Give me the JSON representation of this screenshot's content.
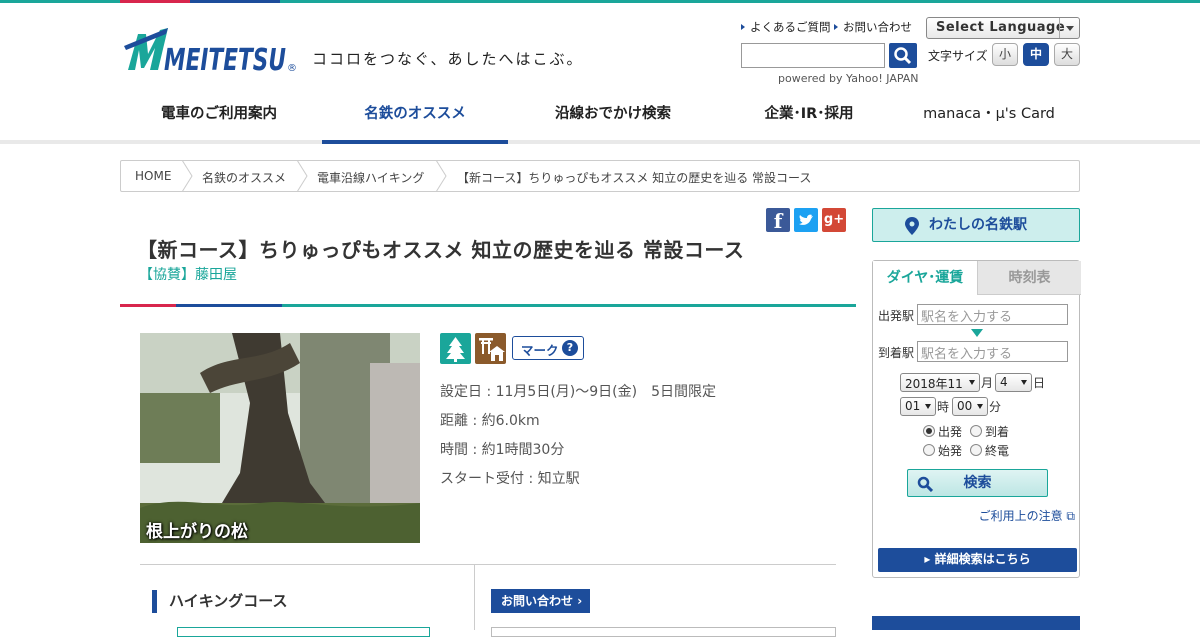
{
  "colors": {
    "teal": "#1aa69a",
    "navy": "#1d4d9b",
    "red": "#d8264d"
  },
  "header": {
    "logo_text": "MEITETSU",
    "logo_mark": "®",
    "tagline": "ココロをつなぐ、あしたへはこぶ。",
    "faq": "よくあるご質問",
    "contact": "お問い合わせ",
    "language": "Select Language",
    "powered": "powered by Yahoo! JAPAN",
    "fontsize_label": "文字サイズ",
    "fontsize": [
      "小",
      "中",
      "大"
    ],
    "fontsize_active": "中"
  },
  "nav": [
    "電車のご利用案内",
    "名鉄のオススメ",
    "沿線おでかけ検索",
    "企業･IR･採用",
    "manaca・μ's Card"
  ],
  "nav_active": "名鉄のオススメ",
  "breadcrumb": [
    "HOME",
    "名鉄のオススメ",
    "電車沿線ハイキング",
    "【新コース】ちりゅっぴもオススメ 知立の歴史を辿る 常設コース"
  ],
  "social": {
    "facebook": "f",
    "twitter": "twitter-icon",
    "googleplus": "g+"
  },
  "article": {
    "title": "【新コース】ちりゅっぴもオススメ 知立の歴史を辿る 常設コース",
    "sponsor": "【協賛】藤田屋",
    "photo_caption": "根上がりの松",
    "mark_button": "マーク",
    "mark_help": "?",
    "details": [
      "設定日 : 11月5日(月)～9日(金)　5日間限定",
      "距離 : 約6.0km",
      "時間 : 約1時間30分",
      "スタート受付 : 知立駅"
    ],
    "hiking_course": "ハイキングコース",
    "contact_button": "お問い合わせ"
  },
  "sidebar": {
    "my_station": "わたしの名鉄駅",
    "tabs": [
      "ダイヤ･運賃",
      "時刻表"
    ],
    "from_label": "出発駅",
    "to_label": "到着駅",
    "from_placeholder": "駅名を入力する",
    "to_placeholder": "駅名を入力する",
    "year_month": "2018年11",
    "day": "4",
    "hour": "01",
    "minute": "00",
    "unit_month": "月",
    "unit_day": "日",
    "unit_hour": "時",
    "unit_minute": "分",
    "radios": [
      "出発",
      "到着",
      "始発",
      "終電"
    ],
    "radio_checked": "出発",
    "search": "検索",
    "notice": "ご利用上の注意",
    "detail": "詳細検索はこちら"
  }
}
